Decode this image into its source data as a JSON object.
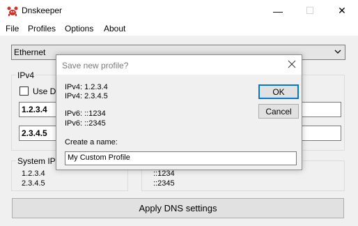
{
  "window": {
    "title": "Dnskeeper",
    "minimize": "—",
    "maximize": "☐",
    "close": "✕"
  },
  "menu": [
    "File",
    "Profiles",
    "Options",
    "About"
  ],
  "adapter": {
    "selected": "Ethernet"
  },
  "ipv4": {
    "label": "IPv4",
    "use_dhcp_label": "Use DH",
    "dns1": "1.2.3.4",
    "dns2": "2.3.4.5"
  },
  "system_ipv4": {
    "label": "System IPv4",
    "values": [
      "1.2.3.4",
      "2.3.4.5"
    ]
  },
  "system_ipv6": {
    "values": [
      "::1234",
      "::2345"
    ]
  },
  "apply_label": "Apply DNS settings",
  "dialog": {
    "title": "Save new profile?",
    "lines": [
      "IPv4:  1.2.3.4",
      "IPv4:  2.3.4.5",
      "IPv6:  ::1234",
      "IPv6:  ::2345"
    ],
    "name_prompt": "Create a name:",
    "name_value": "My Custom Profile",
    "ok_label": "OK",
    "cancel_label": "Cancel"
  },
  "colors": {
    "accent": "#0078d7",
    "icon_red": "#d2322d"
  }
}
